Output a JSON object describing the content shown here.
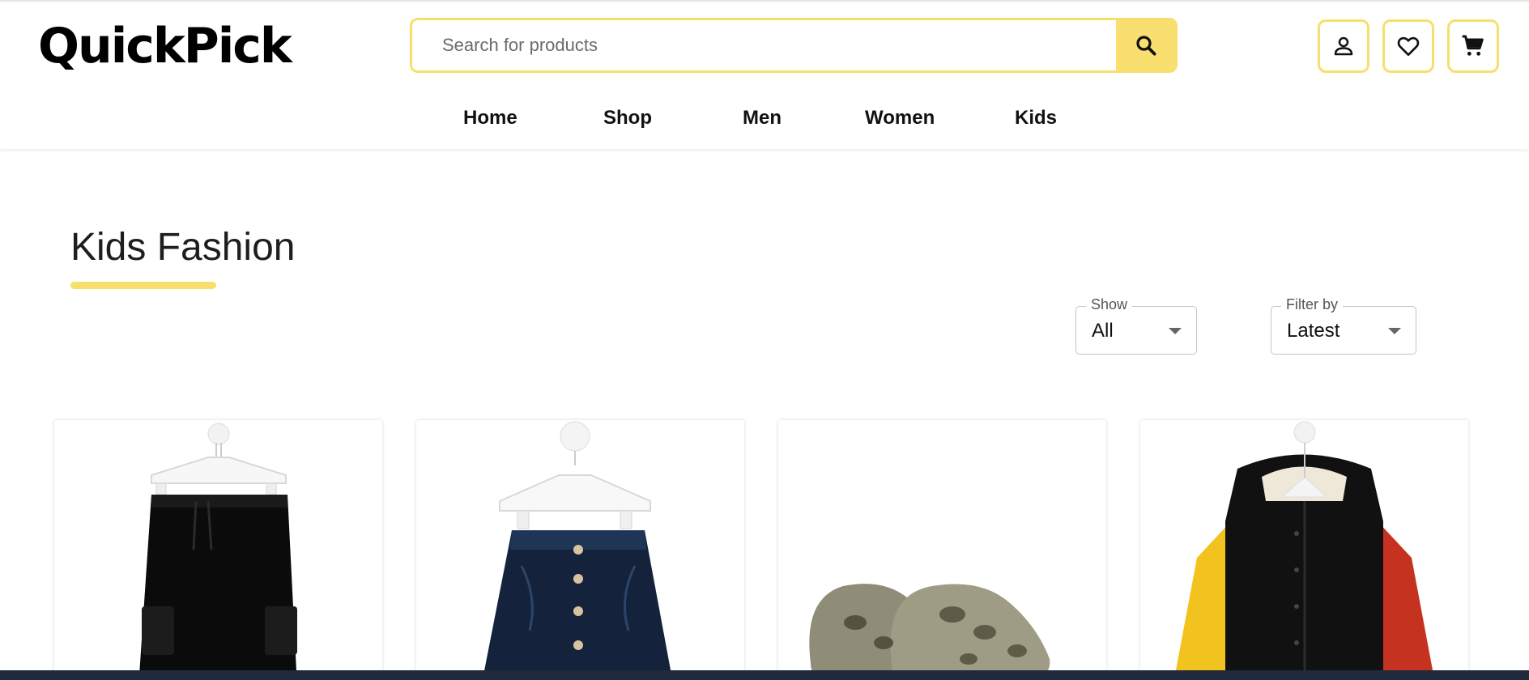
{
  "header": {
    "logo": "QuickPick",
    "search": {
      "placeholder": "Search for products",
      "value": ""
    },
    "icons": {
      "search": "search-icon",
      "account": "user-icon",
      "wishlist": "heart-icon",
      "cart": "cart-icon"
    }
  },
  "nav": {
    "items": [
      {
        "label": "Home"
      },
      {
        "label": "Shop"
      },
      {
        "label": "Men"
      },
      {
        "label": "Women"
      },
      {
        "label": "Kids"
      }
    ]
  },
  "page": {
    "title": "Kids Fashion",
    "show": {
      "label": "Show",
      "value": "All"
    },
    "filter": {
      "label": "Filter by",
      "value": "Latest"
    }
  },
  "products": [
    {
      "image": "black cargo pants on hanger"
    },
    {
      "image": "denim skirt on hanger"
    },
    {
      "image": "olive foam clogs"
    },
    {
      "image": "color-block puffer jacket on hanger"
    }
  ],
  "colors": {
    "accent": "#f8df6b",
    "text": "#111111"
  }
}
